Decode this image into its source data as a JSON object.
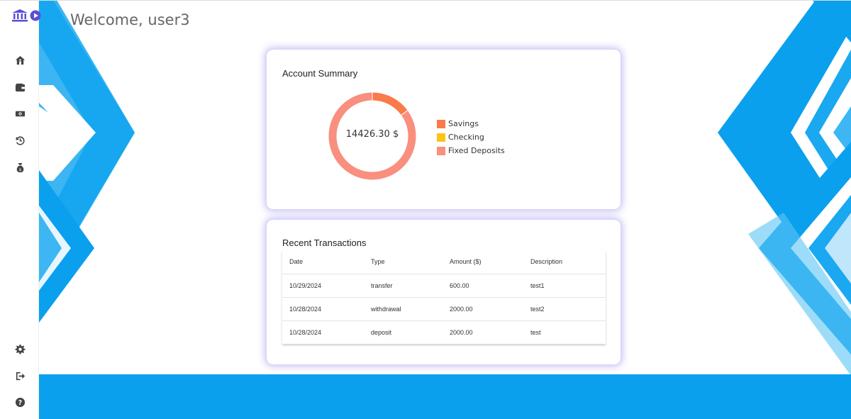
{
  "header": {
    "welcome": "Welcome, user3"
  },
  "sidebar": {
    "top_icons": [
      "home-icon",
      "wallet-icon",
      "money-icon",
      "history-icon",
      "money-bag-icon"
    ],
    "bottom_icons": [
      "settings-icon",
      "logout-icon",
      "help-icon"
    ]
  },
  "summary": {
    "title": "Account Summary",
    "total": "14426.30 $",
    "legend": [
      {
        "label": "Savings",
        "color": "#f97a4a"
      },
      {
        "label": "Checking",
        "color": "#fcc419"
      },
      {
        "label": "Fixed Deposits",
        "color": "#f98f7e"
      }
    ]
  },
  "chart_data": {
    "type": "pie",
    "categories": [
      "Savings",
      "Checking",
      "Fixed Deposits"
    ],
    "values": [
      0.15,
      0.0,
      0.85
    ],
    "title": "Account Summary",
    "center_label": "14426.30 $"
  },
  "transactions": {
    "title": "Recent Transactions",
    "columns": [
      "Date",
      "Type",
      "Amount ($)",
      "Description"
    ],
    "rows": [
      [
        "10/29/2024",
        "transfer",
        "600.00",
        "test1"
      ],
      [
        "10/28/2024",
        "withdrawal",
        "2000.00",
        "test2"
      ],
      [
        "10/28/2024",
        "deposit",
        "2000.00",
        "test"
      ]
    ]
  },
  "colors": {
    "accent": "#0aa0ee",
    "card_glow": "#8278eb",
    "logo": "#5b4fd6"
  }
}
